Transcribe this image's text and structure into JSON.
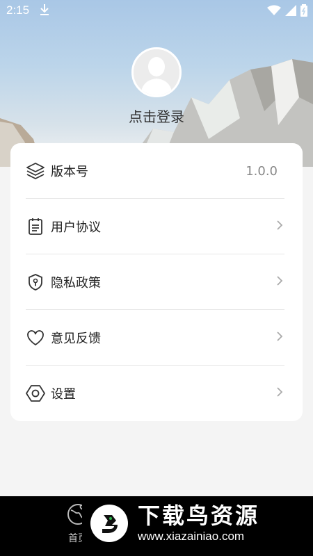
{
  "status_bar": {
    "time": "2:15"
  },
  "profile": {
    "login_label": "点击登录"
  },
  "menu": {
    "version": {
      "label": "版本号",
      "value": "1.0.0"
    },
    "items": [
      {
        "label": "用户协议"
      },
      {
        "label": "隐私政策"
      },
      {
        "label": "意见反馈"
      },
      {
        "label": "设置"
      }
    ]
  },
  "bottom_nav": {
    "home_label": "首页"
  },
  "watermark": {
    "title": "下载鸟资源",
    "url": "www.xiazainiao.com"
  },
  "colors": {
    "card": "#ffffff",
    "page_bg": "#f4f4f4",
    "nav_bg": "#000000",
    "icon_stroke": "#333333"
  }
}
